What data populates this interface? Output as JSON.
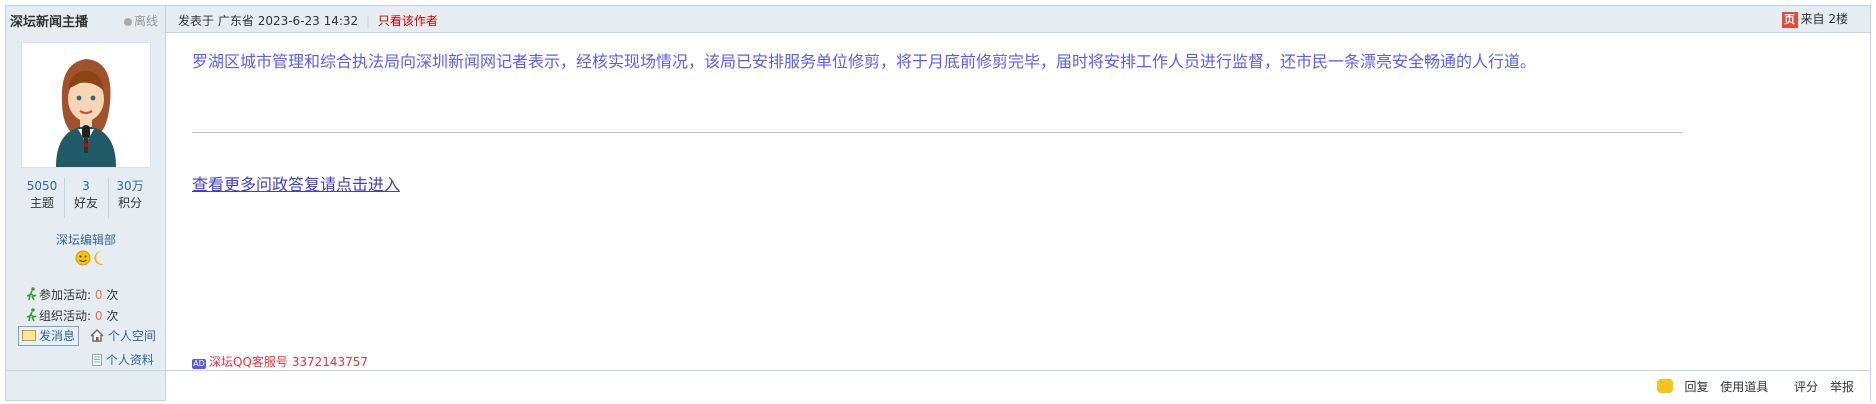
{
  "author": {
    "name": "深坛新闻主播",
    "status": "离线",
    "stats": [
      {
        "value": "5050",
        "label": "主题"
      },
      {
        "value": "3",
        "label": "好友"
      },
      {
        "value": "30万",
        "label": "积分"
      }
    ],
    "group": "深坛编辑部",
    "activities": [
      {
        "label": "参加活动:",
        "count": "0",
        "unit": "次"
      },
      {
        "label": "组织活动:",
        "count": "0",
        "unit": "次"
      }
    ],
    "send_message": "发消息",
    "personal_space": "个人空间",
    "personal_info": "个人资料"
  },
  "post": {
    "posted_prefix": "发表于",
    "location": "广东省",
    "datetime": "2023-6-23 14:32",
    "only_author": "只看该作者",
    "floor_icon": "页",
    "floor_text": "来自 2楼",
    "body": "罗湖区城市管理和综合执法局向深圳新闻网记者表示，经核实现场情况，该局已安排服务单位修剪，将于月底前修剪完毕，届时将安排工作人员进行监督，还市民一条漂亮安全畅通的人行道。",
    "more_link": "查看更多问政答复请点击进入",
    "ad_icon": "AD",
    "ad_text": "深坛QQ客服号 3372143757"
  },
  "footer": {
    "reply": "回复",
    "use_item": "使用道具",
    "rate": "评分",
    "report": "举报"
  },
  "colors": {
    "border": "#c2d5e3",
    "sidebar_bg": "#e5edf2",
    "link": "#336699",
    "body_text": "#5b5bff",
    "accent_red": "#f0303e"
  }
}
